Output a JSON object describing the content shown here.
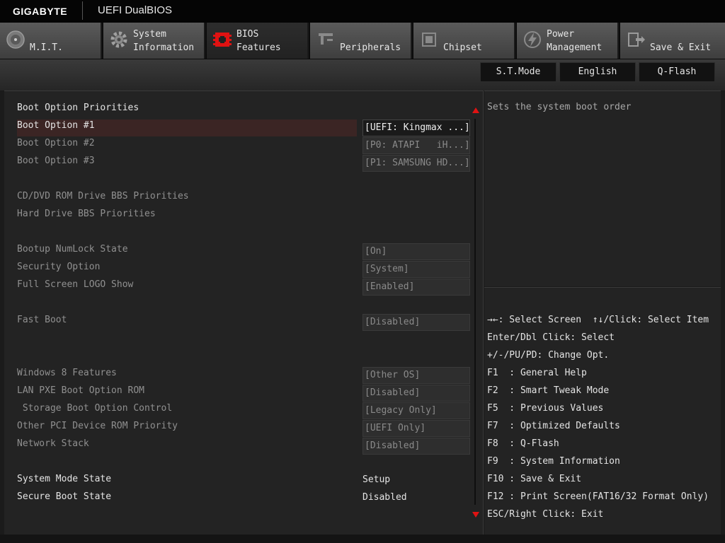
{
  "header": {
    "brand": "GIGABYTE",
    "product": "UEFI DualBIOS"
  },
  "tabs": [
    {
      "label": "M.I.T.",
      "icon": "gauge-icon"
    },
    {
      "label": "System\nInformation",
      "icon": "gear-icon"
    },
    {
      "label": "BIOS\nFeatures",
      "icon": "bios-chip-icon",
      "active": true
    },
    {
      "label": "Peripherals",
      "icon": "peripherals-icon"
    },
    {
      "label": "Chipset",
      "icon": "chipset-icon"
    },
    {
      "label": "Power\nManagement",
      "icon": "power-icon"
    },
    {
      "label": "Save & Exit",
      "icon": "exit-door-icon"
    }
  ],
  "toolbar": {
    "st_mode": "S.T.Mode",
    "language": "English",
    "qflash": "Q-Flash"
  },
  "settings": {
    "section_title": "Boot Option Priorities",
    "boot1": {
      "label": "Boot Option #1",
      "value": "[UEFI: Kingmax ...]"
    },
    "boot2": {
      "label": "Boot Option #2",
      "value": "[P0: ATAPI   iH...]"
    },
    "boot3": {
      "label": "Boot Option #3",
      "value": "[P1: SAMSUNG HD...]"
    },
    "cd_dvd": "CD/DVD ROM Drive BBS Priorities",
    "hard_drive": "Hard Drive BBS Priorities",
    "numlock": {
      "label": "Bootup NumLock State",
      "value": "[On]"
    },
    "security": {
      "label": "Security Option",
      "value": "[System]"
    },
    "logo": {
      "label": "Full Screen LOGO Show",
      "value": "[Enabled]"
    },
    "fastboot": {
      "label": "Fast Boot",
      "value": "[Disabled]"
    },
    "win8": {
      "label": "Windows 8 Features",
      "value": "[Other OS]"
    },
    "lanpxe": {
      "label": "LAN PXE Boot Option ROM",
      "value": "[Disabled]"
    },
    "storage": {
      "label": " Storage Boot Option Control",
      "value": "[Legacy Only]"
    },
    "otherpci": {
      "label": "Other PCI Device ROM Priority",
      "value": "[UEFI Only]"
    },
    "network": {
      "label": "Network Stack",
      "value": "[Disabled]"
    },
    "sysmode": {
      "label": "System Mode State",
      "value": "Setup"
    },
    "secureboot": {
      "label": "Secure Boot State",
      "value": "Disabled"
    }
  },
  "help": {
    "text": "Sets the system boot order"
  },
  "keys": [
    "→←: Select Screen  ↑↓/Click: Select Item",
    "Enter/Dbl Click: Select",
    "+/-/PU/PD: Change Opt.",
    "F1  : General Help",
    "F2  : Smart Tweak Mode",
    "F5  : Previous Values",
    "F7  : Optimized Defaults",
    "F8  : Q-Flash",
    "F9  : System Information",
    "F10 : Save & Exit",
    "F12 : Print Screen(FAT16/32 Format Only)",
    "ESC/Right Click: Exit"
  ],
  "colors": {
    "accent": "#e01212",
    "highlight_row": "#3b2524"
  }
}
